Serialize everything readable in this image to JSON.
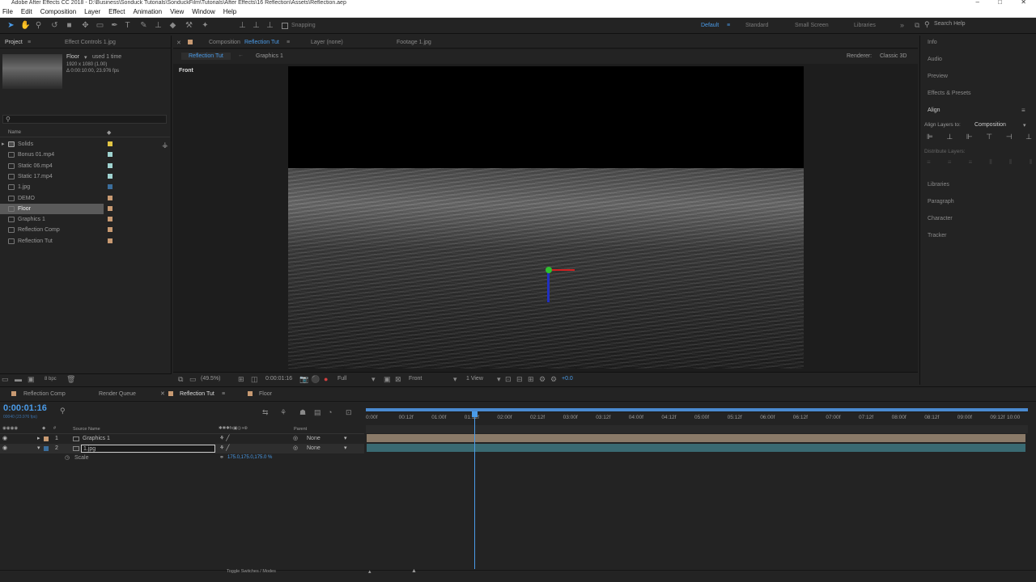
{
  "app_title": "Adobe After Effects CC 2018 - D:\\Business\\Sonduck Tutorials\\SonduckFilm\\Tutorials\\After Effects\\16 Reflection\\Assets\\Reflection.aep",
  "menu": [
    "File",
    "Edit",
    "Composition",
    "Layer",
    "Effect",
    "Animation",
    "View",
    "Window",
    "Help"
  ],
  "toolbar": {
    "snapping": "Snapping",
    "workspaces": [
      "Default",
      "Standard",
      "Small Screen",
      "Libraries"
    ],
    "search_placeholder": "Search Help"
  },
  "project": {
    "tab": "Project",
    "effect_tab": "Effect Controls 1.jpg",
    "sel_name": "Floor",
    "sel_used": "used 1 time",
    "sel_dim": "1920 x 1080 (1.00)",
    "sel_dur": "Δ 0:00:10:00, 23.976 fps",
    "col_name": "Name",
    "search_icon": "search-icon",
    "items": [
      "Solids",
      "Bonus 01.mp4",
      "Static 06.mp4",
      "Static 17.mp4",
      "1.jpg",
      "DEMO",
      "Floor",
      "Graphics 1",
      "Reflection Comp",
      "Reflection Tut"
    ],
    "label_colors": [
      "#e2c544",
      "#9fd3d0",
      "#9fd3d0",
      "#9fd3d0",
      "#3b6e9c",
      "#c89a72",
      "#c89a72",
      "#c89a72",
      "#c89a72",
      "#c89a72"
    ],
    "bpc": "8 bpc"
  },
  "viewer": {
    "comp_tab_prefix": "Composition",
    "comp_tab_name": "Reflection Tut",
    "layer_tab": "Layer (none)",
    "footage_tab": "Footage 1.jpg",
    "sub_tabs": [
      "Reflection Tut",
      "Graphics 1"
    ],
    "renderer_label": "Renderer:",
    "renderer_value": "Classic 3D",
    "view_name": "Front",
    "zoom": "(49.5%)",
    "timecode": "0:00:01:16",
    "resolution": "Full",
    "view_select": "Front",
    "views": "1 View",
    "exposure": "+0.0"
  },
  "right_panel": {
    "items_top": [
      "Info",
      "Audio",
      "Preview",
      "Effects & Presets",
      "Align"
    ],
    "align_to_label": "Align Layers to:",
    "align_to_value": "Composition",
    "distribute_label": "Distribute Layers:",
    "items_bottom": [
      "Libraries",
      "Paragraph",
      "Character",
      "Tracker"
    ]
  },
  "timeline": {
    "tabs": [
      "Reflection Comp",
      "Render Queue",
      "Reflection Tut",
      "Floor"
    ],
    "timecode": "0:00:01:16",
    "frames_sub": "00040 (23.976 fps)",
    "search_placeholder": "",
    "col_source": "Source Name",
    "col_parent": "Parent",
    "layers": [
      {
        "num": "1",
        "name": "Graphics 1",
        "parent": "None"
      },
      {
        "num": "2",
        "name": "1.jpg",
        "parent": "None"
      }
    ],
    "prop_name": "Scale",
    "prop_value": "175.0,175.0,175.0 %",
    "ruler": [
      "0:00f",
      "00:12f",
      "01:00f",
      "01:12f",
      "02:00f",
      "02:12f",
      "03:00f",
      "03:12f",
      "04:00f",
      "04:12f",
      "05:00f",
      "05:12f",
      "06:00f",
      "06:12f",
      "07:00f",
      "07:12f",
      "08:00f",
      "08:12f",
      "09:00f",
      "09:12f",
      "10:00"
    ],
    "toggle_label": "Toggle Switches / Modes",
    "playhead_fraction": 0.163
  }
}
